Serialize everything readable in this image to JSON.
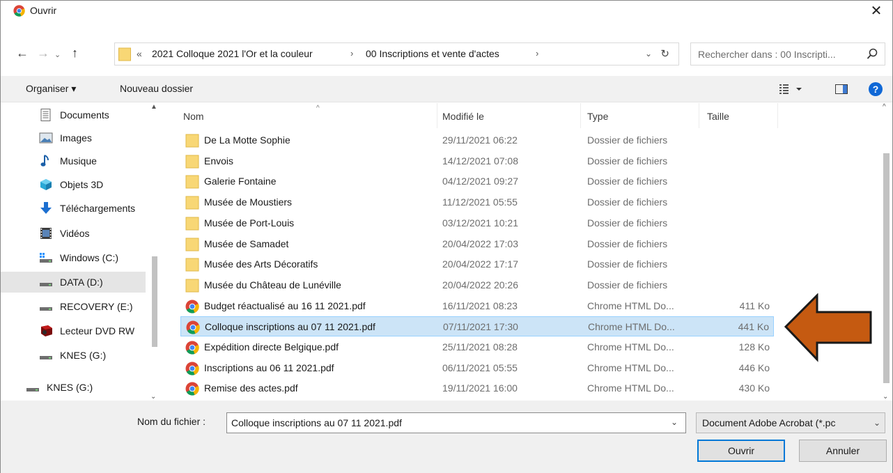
{
  "window": {
    "title": "Ouvrir",
    "close_glyph": "✕",
    "app_icon": "chrome-icon"
  },
  "navigation": {
    "back_glyph": "←",
    "forward_glyph": "→",
    "recent_glyph": "⌄",
    "up_glyph": "↑",
    "address": {
      "prefix": "«",
      "crumbs": [
        "2021 Colloque 2021 l'Or et la couleur",
        "00 Inscriptions et vente d'actes"
      ],
      "separator": "›",
      "dropdown_glyph": "⌄",
      "refresh_glyph": "↻"
    },
    "search": {
      "placeholder": "Rechercher dans : 00 Inscripti..."
    }
  },
  "toolbar": {
    "organise_label": "Organiser ▾",
    "new_folder_label": "Nouveau dossier",
    "help_label": "?"
  },
  "sidebar": {
    "scroll_up": "▲",
    "scroll_down": "⌄",
    "items": [
      {
        "label": "Documents",
        "icon": "documents-icon"
      },
      {
        "label": "Images",
        "icon": "images-icon"
      },
      {
        "label": "Musique",
        "icon": "music-icon"
      },
      {
        "label": "Objets 3D",
        "icon": "3d-objects-icon"
      },
      {
        "label": "Téléchargements",
        "icon": "downloads-icon"
      },
      {
        "label": "Vidéos",
        "icon": "videos-icon"
      },
      {
        "label": "Windows (C:)",
        "icon": "windows-drive-icon"
      },
      {
        "label": "DATA (D:)",
        "icon": "drive-icon",
        "selected": true
      },
      {
        "label": "RECOVERY (E:)",
        "icon": "drive-icon"
      },
      {
        "label": "Lecteur DVD RW",
        "icon": "dvd-drive-icon"
      },
      {
        "label": "KNES (G:)",
        "icon": "drive-icon"
      },
      {
        "label": "KNES (G:)",
        "icon": "drive-icon"
      }
    ]
  },
  "filelist": {
    "columns": {
      "name": "Nom",
      "modified": "Modifié le",
      "type": "Type",
      "size": "Taille"
    },
    "sort_glyph": "^",
    "scroll_up": "^",
    "scroll_down": "⌄",
    "rows": [
      {
        "name": "De La Motte Sophie",
        "modified": "29/11/2021 06:22",
        "type": "Dossier de fichiers",
        "size": "",
        "icon": "folder"
      },
      {
        "name": "Envois",
        "modified": "14/12/2021 07:08",
        "type": "Dossier de fichiers",
        "size": "",
        "icon": "folder"
      },
      {
        "name": "Galerie Fontaine",
        "modified": "04/12/2021 09:27",
        "type": "Dossier de fichiers",
        "size": "",
        "icon": "folder"
      },
      {
        "name": "Musée de Moustiers",
        "modified": "11/12/2021 05:55",
        "type": "Dossier de fichiers",
        "size": "",
        "icon": "folder"
      },
      {
        "name": "Musée de Port-Louis",
        "modified": "03/12/2021 10:21",
        "type": "Dossier de fichiers",
        "size": "",
        "icon": "folder"
      },
      {
        "name": "Musée de Samadet",
        "modified": "20/04/2022 17:03",
        "type": "Dossier de fichiers",
        "size": "",
        "icon": "folder"
      },
      {
        "name": "Musée des Arts Décoratifs",
        "modified": "20/04/2022 17:17",
        "type": "Dossier de fichiers",
        "size": "",
        "icon": "folder"
      },
      {
        "name": "Musée du Château de Lunéville",
        "modified": "20/04/2022 20:26",
        "type": "Dossier de fichiers",
        "size": "",
        "icon": "folder"
      },
      {
        "name": "Budget réactualisé au 16 11 2021.pdf",
        "modified": "16/11/2021 08:23",
        "type": "Chrome HTML Do...",
        "size": "411 Ko",
        "icon": "chrome"
      },
      {
        "name": "Colloque inscriptions au 07 11 2021.pdf",
        "modified": "07/11/2021 17:30",
        "type": "Chrome HTML Do...",
        "size": "441 Ko",
        "icon": "chrome",
        "selected": true
      },
      {
        "name": "Expédition directe Belgique.pdf",
        "modified": "25/11/2021 08:28",
        "type": "Chrome HTML Do...",
        "size": "128 Ko",
        "icon": "chrome"
      },
      {
        "name": "Inscriptions au 06 11 2021.pdf",
        "modified": "06/11/2021 05:55",
        "type": "Chrome HTML Do...",
        "size": "446 Ko",
        "icon": "chrome"
      },
      {
        "name": "Remise des actes.pdf",
        "modified": "19/11/2021 16:00",
        "type": "Chrome HTML Do...",
        "size": "430 Ko",
        "icon": "chrome"
      }
    ]
  },
  "footer": {
    "filename_label": "Nom du fichier :",
    "filename_value": "Colloque inscriptions au 07 11 2021.pdf",
    "filename_drop": "⌄",
    "filetype_value": "Document Adobe Acrobat (*.pc",
    "filetype_drop": "⌄",
    "open_label": "Ouvrir",
    "cancel_label": "Annuler"
  },
  "colors": {
    "selection_bg": "#cce4f7",
    "selection_border": "#99d1ff",
    "accent": "#0078d7",
    "folder": "#f8d775",
    "annotation_arrow": "#c55a11"
  }
}
